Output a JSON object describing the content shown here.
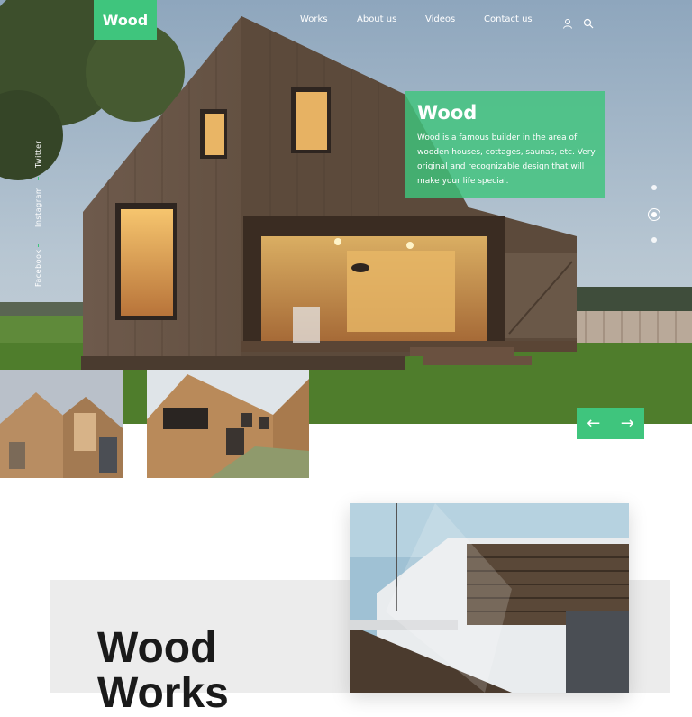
{
  "brand": {
    "logo": "Wood",
    "accent": "#3fc57d"
  },
  "nav": {
    "items": [
      "Works",
      "About us",
      "Videos",
      "Contact us"
    ],
    "icons": [
      "user-icon",
      "search-icon"
    ]
  },
  "social": [
    "Facebook",
    "Instagram",
    "Twitter"
  ],
  "hero_card": {
    "title": "Wood",
    "text": "Wood is a famous builder in the area of wooden houses, cottages, saunas, etc. Very original and recognizable design that will make your life special."
  },
  "slider": {
    "total": 3,
    "active": 2,
    "prev_icon": "arrow-left-icon",
    "next_icon": "arrow-right-icon",
    "prev": "←",
    "next": "→"
  },
  "works": {
    "title_line1": "Wood",
    "title_line2": "Works"
  }
}
